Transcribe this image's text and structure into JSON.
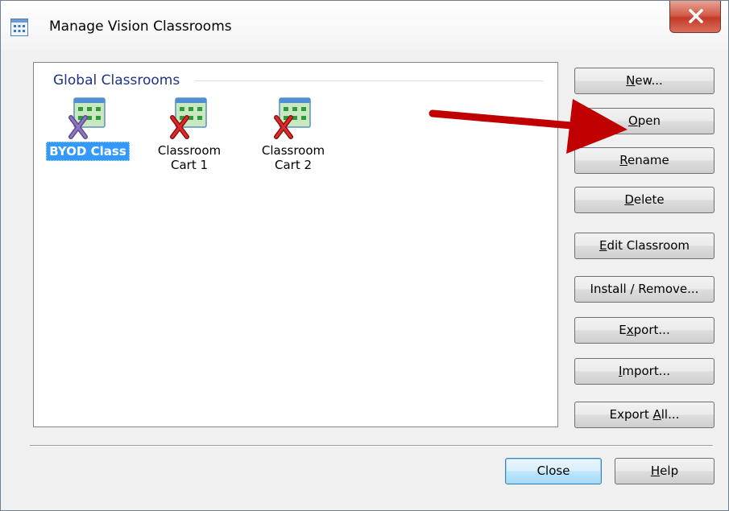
{
  "window": {
    "title": "Manage Vision Classrooms"
  },
  "icons": {
    "title_icon": "classroom-grid-icon",
    "close": "close-x-icon",
    "classroom": "classroom-grid-icon",
    "remove_mark": "x-mark-icon",
    "annotation": "red-arrow"
  },
  "colors": {
    "selection": "#3399ff",
    "group_header": "#1e3287",
    "arrow": "#c00000",
    "close_button": "#c43b28"
  },
  "list": {
    "group_header": "Global Classrooms",
    "items": [
      {
        "label": "BYOD Class",
        "selected": true,
        "mark": "purple-x"
      },
      {
        "label": "Classroom\nCart 1",
        "selected": false,
        "mark": "red-x"
      },
      {
        "label": "Classroom\nCart 2",
        "selected": false,
        "mark": "red-x"
      }
    ]
  },
  "buttons": {
    "new": {
      "before": "",
      "accel": "N",
      "after": "ew..."
    },
    "open": {
      "before": "",
      "accel": "O",
      "after": "pen"
    },
    "rename": {
      "before": "",
      "accel": "R",
      "after": "ename"
    },
    "delete": {
      "before": "",
      "accel": "D",
      "after": "elete"
    },
    "edit": {
      "before": "",
      "accel": "E",
      "after": "dit Classroom"
    },
    "install": {
      "before": "Install / Remove...",
      "accel": "",
      "after": ""
    },
    "export": {
      "before": "E",
      "accel": "x",
      "after": "port..."
    },
    "import": {
      "before": "",
      "accel": "I",
      "after": "mport..."
    },
    "export_all": {
      "before": "Export ",
      "accel": "A",
      "after": "ll..."
    },
    "close": {
      "before": "Close",
      "accel": "",
      "after": ""
    },
    "help": {
      "before": "",
      "accel": "H",
      "after": "elp"
    }
  }
}
